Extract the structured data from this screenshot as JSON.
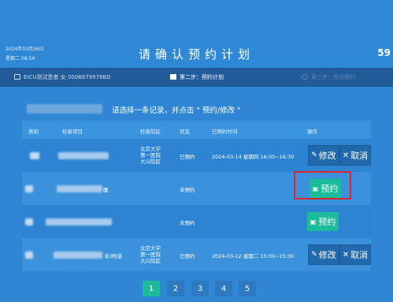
{
  "header": {
    "date": "2024年03月26日",
    "time": "星期二 08:54",
    "title": "请确认预约计划",
    "countdown": "59"
  },
  "steps": [
    {
      "label": "EICU测试患者 女 0006679978BD"
    },
    {
      "label": "第二步：预约计划"
    },
    {
      "label": "第三步：完成预约"
    }
  ],
  "instruction": "请选择一条记录，并点击 \" 预约/修改 \"",
  "table": {
    "headers": [
      "类别",
      "检查项目",
      "检查院区",
      "状态",
      "已预约时间",
      "操作"
    ],
    "rows": [
      {
        "hospital": "北京大学\n第一医院\n大兴院区",
        "status": "已预约",
        "time": "2024-03-14 星期四 16:00~16:30",
        "edit": "修改",
        "cancel": "取消"
      },
      {
        "hospital": "",
        "status": "未预约",
        "time": "",
        "book": "预约"
      },
      {
        "hospital": "",
        "status": "未预约",
        "time": "",
        "book": "预约"
      },
      {
        "hospital": "北京大学\n第一医院\n大兴院区",
        "status": "已预约",
        "time": "2024-03-12 星期二 15:00~15:30",
        "edit": "修改",
        "cancel": "取消"
      }
    ],
    "partial_item_text_row2": "腹",
    "partial_item_text_row4": "彩)附道"
  },
  "pagination": [
    "1",
    "2",
    "3",
    "4",
    "5"
  ],
  "colors": {
    "background": "#2e86d4",
    "book_button": "#1bbc9b",
    "action_button": "#2169ad",
    "highlight": "#e0232b"
  }
}
